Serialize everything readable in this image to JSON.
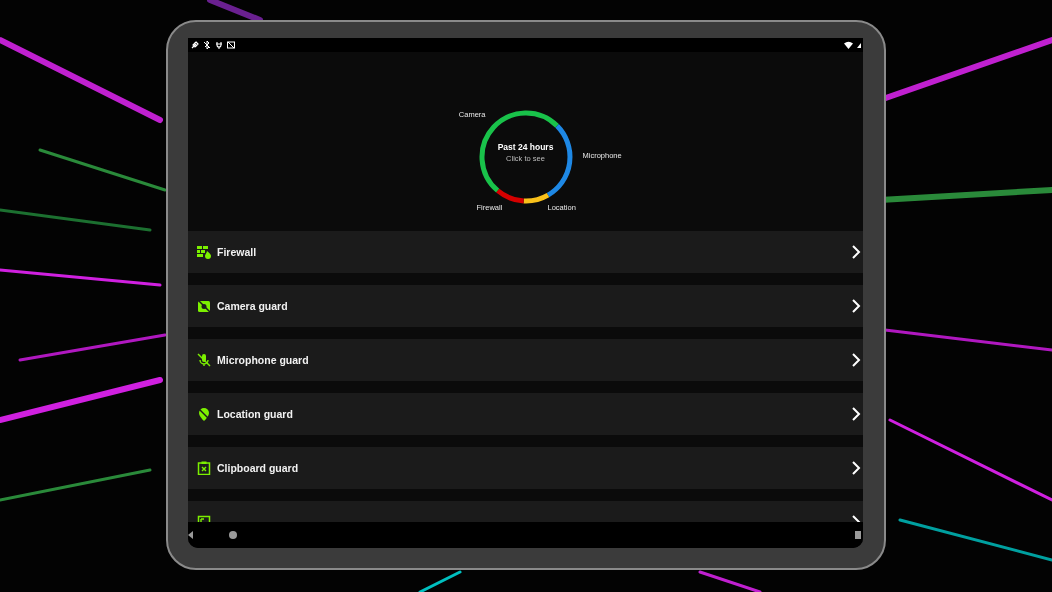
{
  "chart": {
    "title": "Past 24 hours",
    "subtitle": "Click to see",
    "segments": [
      {
        "label": "Camera",
        "color": "#19c24a"
      },
      {
        "label": "Microphone",
        "color": "#1e88e5"
      },
      {
        "label": "Location",
        "color": "#f9c11b"
      },
      {
        "label": "Firewall",
        "color": "#d50000"
      }
    ]
  },
  "items": [
    {
      "kind": "firewall",
      "label": "Firewall"
    },
    {
      "kind": "camera",
      "label": "Camera guard"
    },
    {
      "kind": "microphone",
      "label": "Microphone guard"
    },
    {
      "kind": "location",
      "label": "Location guard"
    },
    {
      "kind": "clipboard",
      "label": "Clipboard guard"
    },
    {
      "kind": "screenshot"
    }
  ]
}
